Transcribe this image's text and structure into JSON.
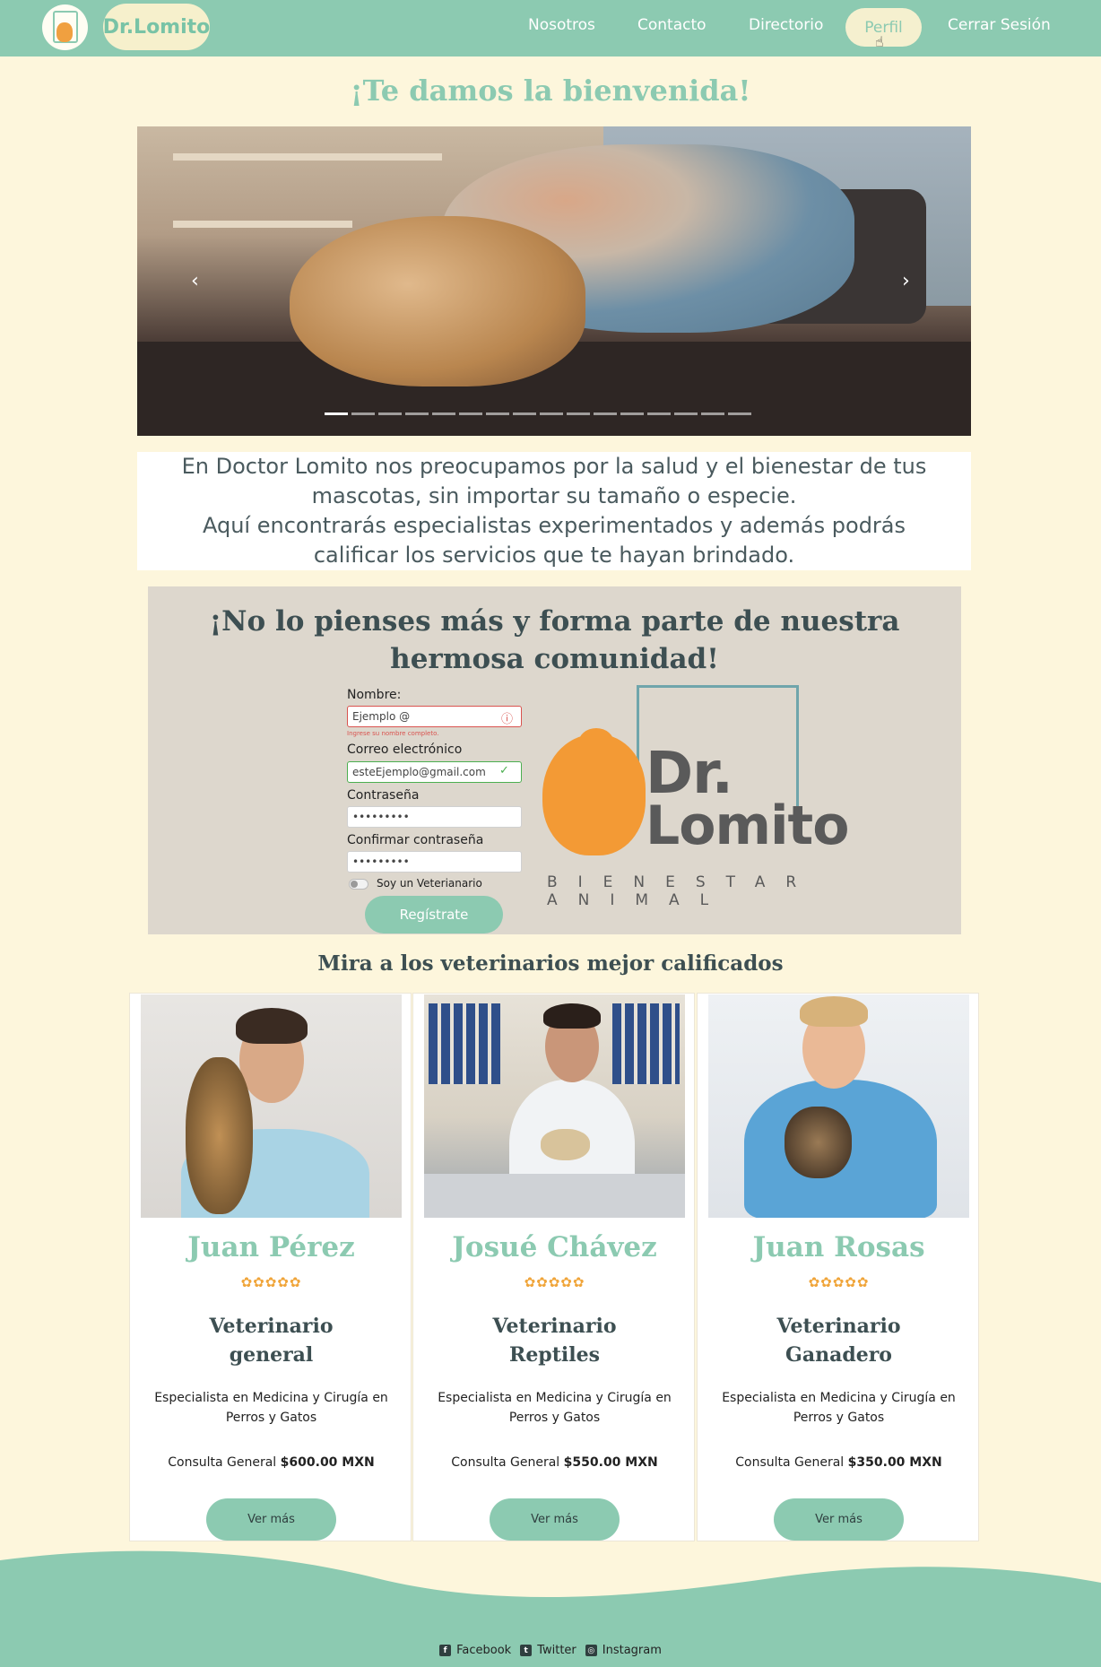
{
  "nav": {
    "brand": "Dr.Lomito",
    "links": [
      "Nosotros",
      "Contacto",
      "Directorio",
      "Perfil",
      "Cerrar Sesión"
    ]
  },
  "welcome": "¡Te damos la bienvenida!",
  "intro": {
    "line1": "En Doctor Lomito nos preocupamos por la salud y el bienestar de tus",
    "line2": "mascotas, sin importar su tamaño o especie.",
    "line3": "Aquí encontrarás especialistas experimentados y además podrás",
    "line4": "calificar los servicios que te hayan brindado."
  },
  "signup": {
    "title_line1": "¡No lo pienses más y forma parte de nuestra",
    "title_line2": "hermosa comunidad!",
    "name_label": "Nombre:",
    "name_value": "Ejemplo @",
    "name_error": "Ingrese su nombre completo.",
    "email_label": "Correo electrónico",
    "email_value": "esteEjemplo@gmail.com",
    "password_label": "Contraseña",
    "password_value": "•••••••••",
    "confirm_label": "Confirmar contraseña",
    "confirm_value": "•••••••••",
    "vet_toggle_label": "Soy un Veterianario",
    "register_button": "Regístrate"
  },
  "logo": {
    "dr": "Dr.",
    "lomito": "Lomito",
    "tagline": "BIENESTAR ANIMAL"
  },
  "vets": {
    "title": "Mira a los veterinarios mejor calificados",
    "cards": [
      {
        "name": "Juan Pérez",
        "rating": 5,
        "stars": "✿✿✿✿✿",
        "specialty_line1": "Veterinario",
        "specialty_line2": "general",
        "description": "Especialista en Medicina y Cirugía en Perros y Gatos",
        "price_label": "Consulta General",
        "price_value": "$600.00 MXN",
        "button": "Ver más"
      },
      {
        "name": "Josué Chávez",
        "rating": 5,
        "stars": "✿✿✿✿✿",
        "specialty_line1": "Veterinario",
        "specialty_line2": "Reptiles",
        "description": "Especialista en Medicina y Cirugía en Perros y Gatos",
        "price_label": "Consulta General",
        "price_value": "$550.00 MXN",
        "button": "Ver más"
      },
      {
        "name": "Juan Rosas",
        "rating": 5,
        "stars": "✿✿✿✿✿",
        "specialty_line1": "Veterinario",
        "specialty_line2": "Ganadero",
        "description": "Especialista en Medicina y Cirugía en Perros y Gatos",
        "price_label": "Consulta General",
        "price_value": "$350.00 MXN",
        "button": "Ver más"
      }
    ]
  },
  "footer": {
    "facebook": "Facebook",
    "twitter": "Twitter",
    "instagram": "Instagram"
  },
  "colors": {
    "accent": "#8ccab1",
    "background": "#fdf6dc",
    "dark_text": "#3d4f52",
    "logo_orange": "#f39a35"
  }
}
